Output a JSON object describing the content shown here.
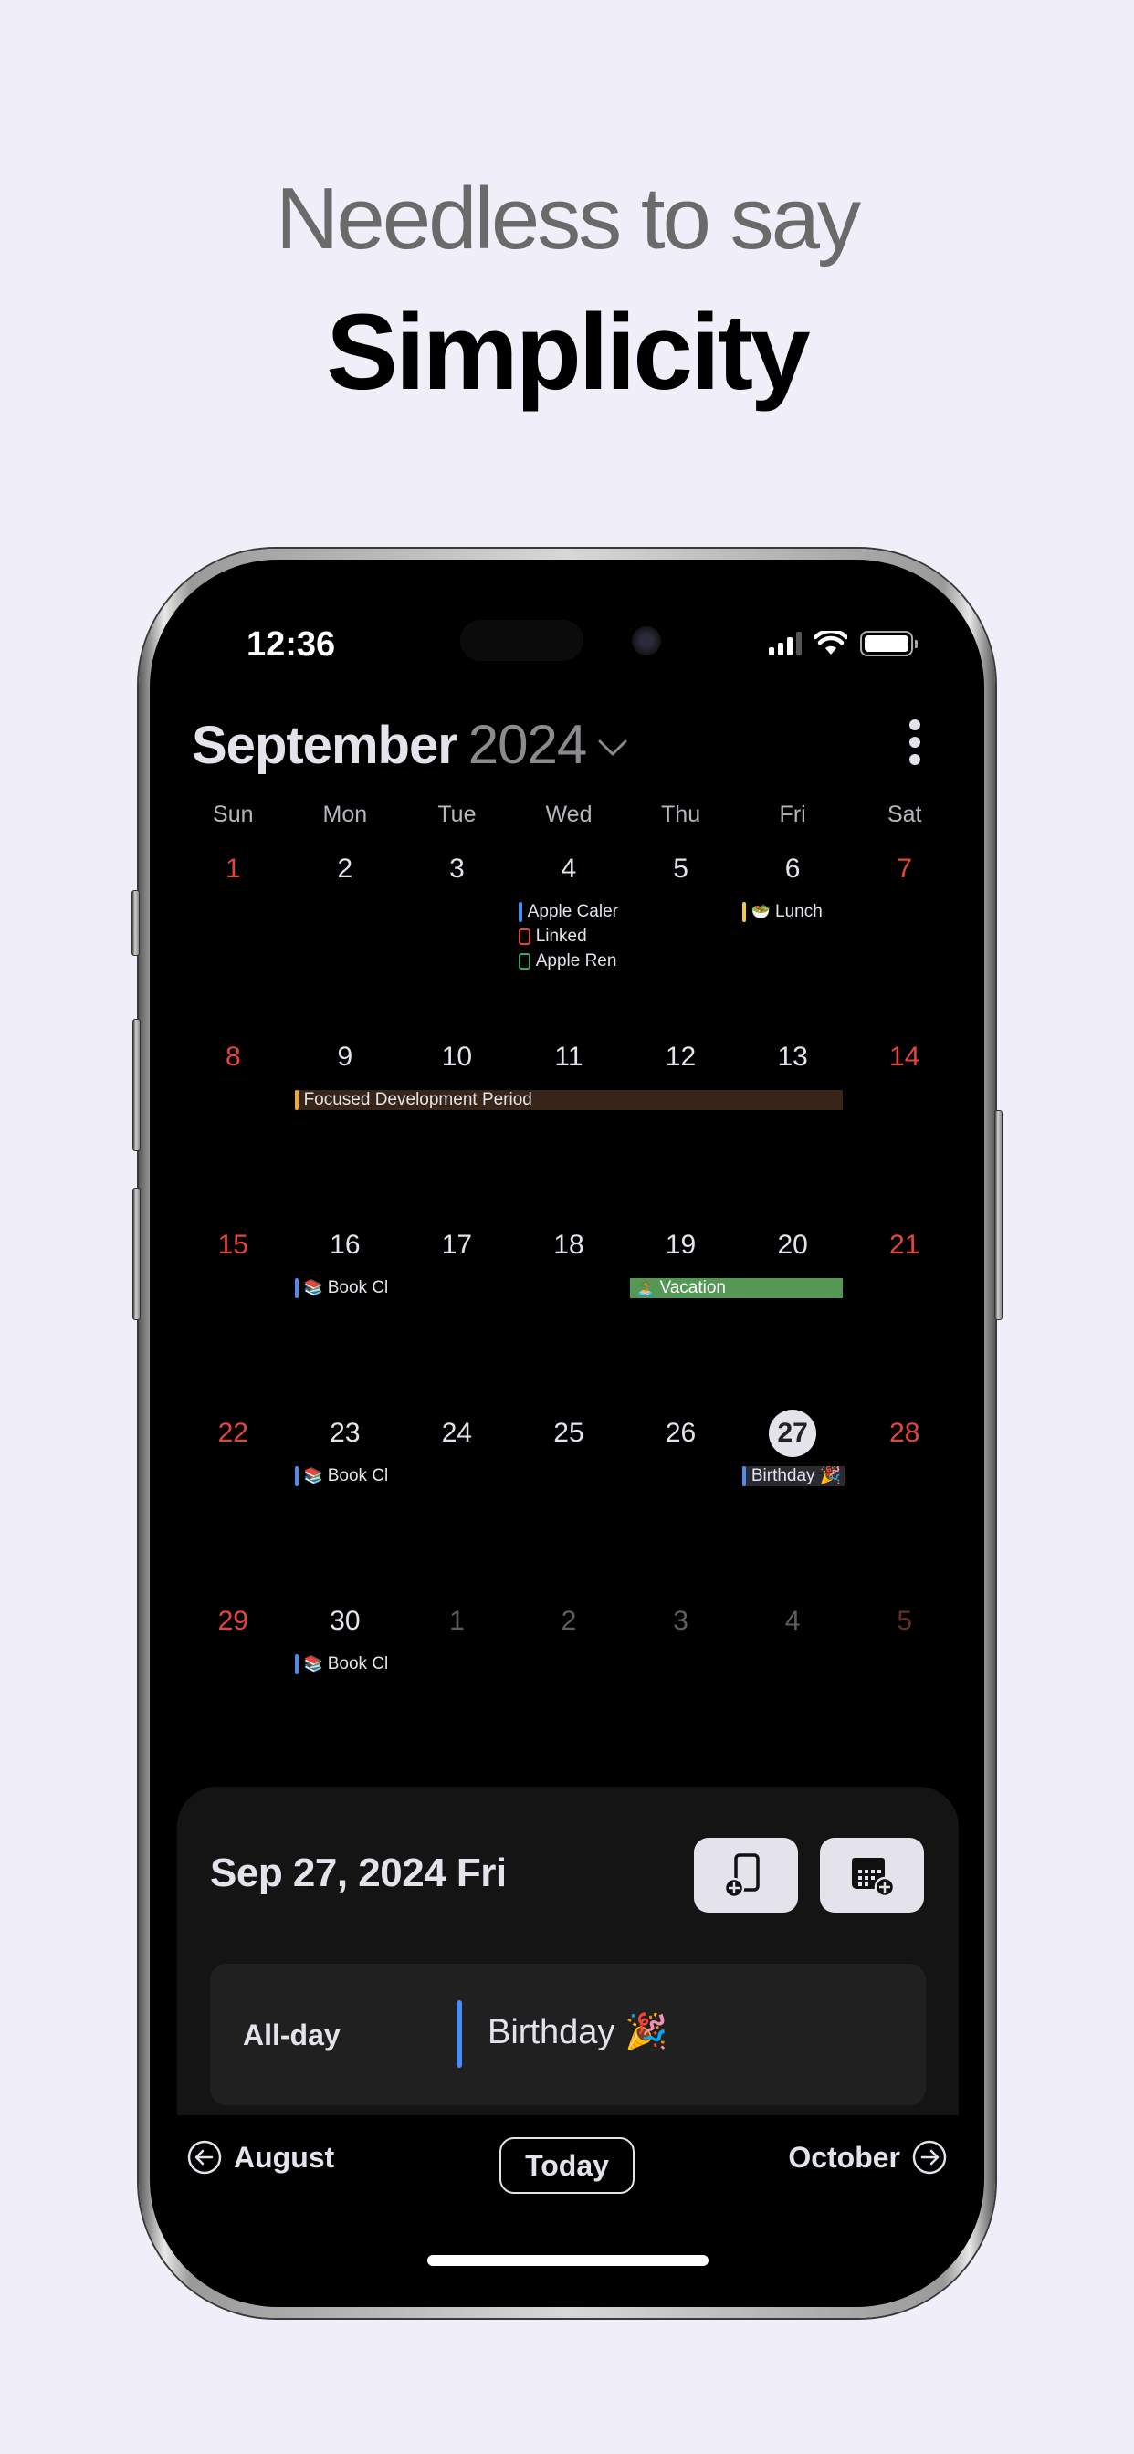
{
  "promo": {
    "subtitle": "Needless to say",
    "title": "Simplicity"
  },
  "status_bar": {
    "time": "12:36",
    "icons": [
      "cellular-signal-icon",
      "wifi-icon",
      "battery-icon"
    ]
  },
  "header": {
    "month": "September",
    "year": "2024",
    "year_picker_icon": "chevron-down-icon",
    "menu_icon": "more-vertical-icon"
  },
  "weekdays": [
    "Sun",
    "Mon",
    "Tue",
    "Wed",
    "Thu",
    "Fri",
    "Sat"
  ],
  "weeks": [
    {
      "days": [
        {
          "num": "1",
          "weekend": true
        },
        {
          "num": "2"
        },
        {
          "num": "3"
        },
        {
          "num": "4"
        },
        {
          "num": "5"
        },
        {
          "num": "6"
        },
        {
          "num": "7",
          "weekend": true
        }
      ],
      "events": [
        {
          "col": 3,
          "slot": 0,
          "title": "Apple Caler",
          "marker": "bar",
          "color": "#4A8CF0"
        },
        {
          "col": 3,
          "slot": 1,
          "title": "Linked",
          "marker": "box",
          "color": "#E5463C"
        },
        {
          "col": 3,
          "slot": 2,
          "title": "Apple Ren",
          "marker": "box",
          "color": "#3FA45B"
        },
        {
          "col": 5,
          "slot": 0,
          "title": "Lunch",
          "marker": "bar",
          "color": "#F5C842",
          "emoji": "🥗"
        }
      ]
    },
    {
      "days": [
        {
          "num": "8",
          "weekend": true
        },
        {
          "num": "9"
        },
        {
          "num": "10"
        },
        {
          "num": "11"
        },
        {
          "num": "12"
        },
        {
          "num": "13"
        },
        {
          "num": "14",
          "weekend": true
        }
      ],
      "events": [
        {
          "col": 1,
          "span": 5,
          "slot": 0,
          "title": "Focused Development Period",
          "marker": "bar",
          "color": "#F5A623",
          "style": "span-orange"
        }
      ]
    },
    {
      "days": [
        {
          "num": "15",
          "weekend": true
        },
        {
          "num": "16"
        },
        {
          "num": "17"
        },
        {
          "num": "18"
        },
        {
          "num": "19"
        },
        {
          "num": "20"
        },
        {
          "num": "21",
          "weekend": true
        }
      ],
      "events": [
        {
          "col": 1,
          "slot": 0,
          "title": "Book Cl",
          "marker": "bar",
          "color": "#4A8CF0",
          "emoji": "📚"
        },
        {
          "col": 4,
          "span": 2,
          "slot": 0,
          "title": "Vacation",
          "marker": "none",
          "color": "#559855",
          "emoji": "🏝️",
          "style": "span-green"
        }
      ]
    },
    {
      "days": [
        {
          "num": "22",
          "weekend": true
        },
        {
          "num": "23"
        },
        {
          "num": "24"
        },
        {
          "num": "25"
        },
        {
          "num": "26"
        },
        {
          "num": "27",
          "today": true
        },
        {
          "num": "28",
          "weekend": true
        }
      ],
      "events": [
        {
          "col": 1,
          "slot": 0,
          "title": "Book Cl",
          "marker": "bar",
          "color": "#4A8CF0",
          "emoji": "📚"
        },
        {
          "col": 5,
          "slot": 0,
          "title": "Birthday 🎉",
          "marker": "bar",
          "color": "#4A8CF0",
          "style": "birthday"
        }
      ]
    },
    {
      "days": [
        {
          "num": "29",
          "weekend": true
        },
        {
          "num": "30"
        },
        {
          "num": "1",
          "outside": true
        },
        {
          "num": "2",
          "outside": true
        },
        {
          "num": "3",
          "outside": true
        },
        {
          "num": "4",
          "outside": true
        },
        {
          "num": "5",
          "weekend": true,
          "outside": true
        }
      ],
      "events": [
        {
          "col": 1,
          "slot": 0,
          "title": "Book Cl",
          "marker": "bar",
          "color": "#4A8CF0",
          "emoji": "📚"
        }
      ]
    }
  ],
  "selected_day": {
    "date_label": "Sep 27, 2024 Fri",
    "actions": [
      {
        "name": "add-reminder-button",
        "icon": "add-reminder-icon"
      },
      {
        "name": "add-event-button",
        "icon": "add-calendar-event-icon"
      }
    ],
    "allday_label": "All-day",
    "allday_event": "Birthday 🎉",
    "allday_event_color": "#4A8CF0"
  },
  "bottom_nav": {
    "prev_label": "August",
    "today_label": "Today",
    "next_label": "October"
  },
  "colors": {
    "background": "#F0EFF9",
    "weekend": "#E5463C",
    "text": "#E4E2EA",
    "accent_blue": "#4A8CF0"
  }
}
